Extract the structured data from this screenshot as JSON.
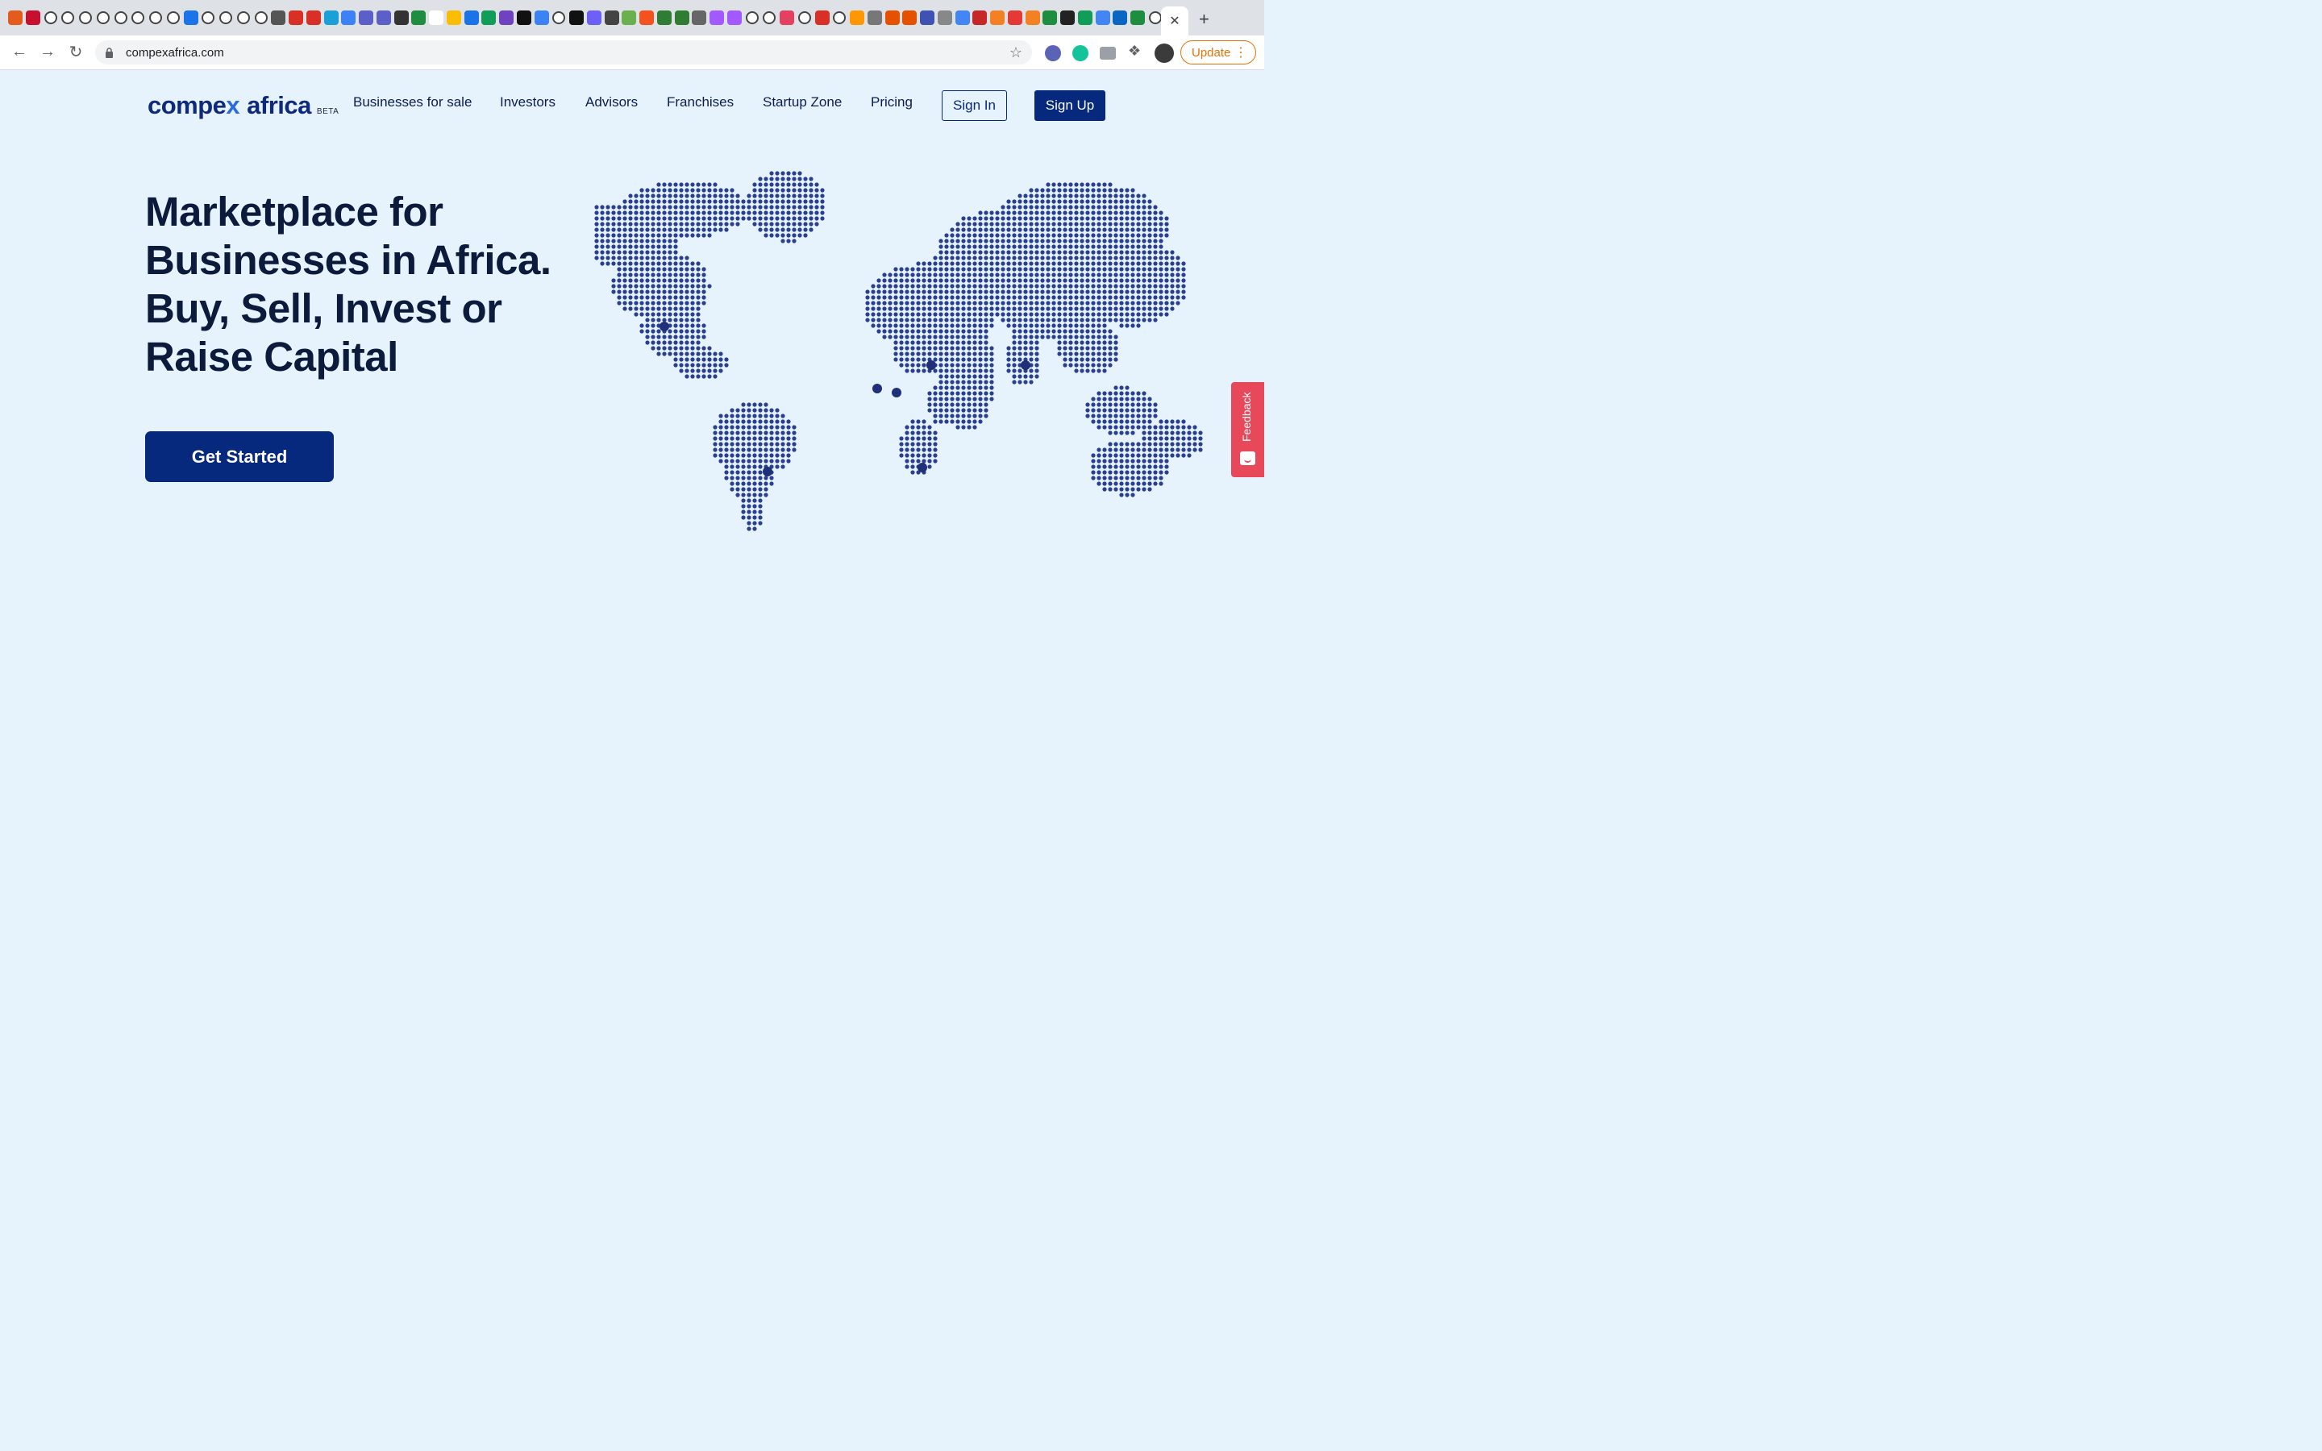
{
  "browser": {
    "url": "compexafrica.com",
    "update_label": "Update",
    "close_tab_glyph": "✕",
    "new_tab_glyph": "+",
    "tab_favicons": [
      "#e45b1c",
      "#c8102e",
      "gh",
      "gh",
      "gh",
      "gh",
      "gh",
      "gh",
      "gh",
      "gh",
      "#1a73e8",
      "gh",
      "gh",
      "gh",
      "gh",
      "#555",
      "#d93025",
      "#d93025",
      "#1a9fd6",
      "#3b82f6",
      "#5b5fc7",
      "#5b5fc7",
      "#333",
      "#1e8e3e",
      "#fff",
      "#fbbc04",
      "#1a73e8",
      "#0f9d58",
      "#6f42c1",
      "#111",
      "#3b82f6",
      "gh",
      "#111",
      "#6e5ff6",
      "#444",
      "#6ab04c",
      "#f4511e",
      "#2e7d32",
      "#2e7d32",
      "#666",
      "#a259ff",
      "#a259ff",
      "gh",
      "gh",
      "#e4405f",
      "gh",
      "#d93025",
      "gh",
      "#ff9800",
      "#777",
      "#e65100",
      "#e65100",
      "#3f51b5",
      "#888",
      "#4285f4",
      "#c62828",
      "#f48024",
      "#e53935",
      "#f48024",
      "#1e8e3e",
      "#222",
      "#0f9d58",
      "#4285f4",
      "#0a66c2",
      "#1e8e3e",
      "gh",
      "#5f6368"
    ]
  },
  "site": {
    "logo_part1": "compe",
    "logo_part2": "x",
    "logo_part3": "africa",
    "beta": "BETA"
  },
  "nav": {
    "items": [
      "Businesses for sale",
      "Investors",
      "Advisors",
      "Franchises",
      "Startup Zone",
      "Pricing"
    ],
    "sign_in": "Sign In",
    "sign_up": "Sign Up"
  },
  "hero": {
    "lines": [
      "Marketplace for",
      "Businesses in Africa.",
      "Buy, Sell, Invest or",
      "Raise Capital"
    ],
    "cta": "Get Started"
  },
  "feedback": {
    "label": "Feedback"
  },
  "colors": {
    "brand": "#06287d",
    "accent": "#2b6cdc",
    "background": "#e6f3fd",
    "map_dot": "#2a3f8f",
    "feedback": "#e8495a"
  }
}
